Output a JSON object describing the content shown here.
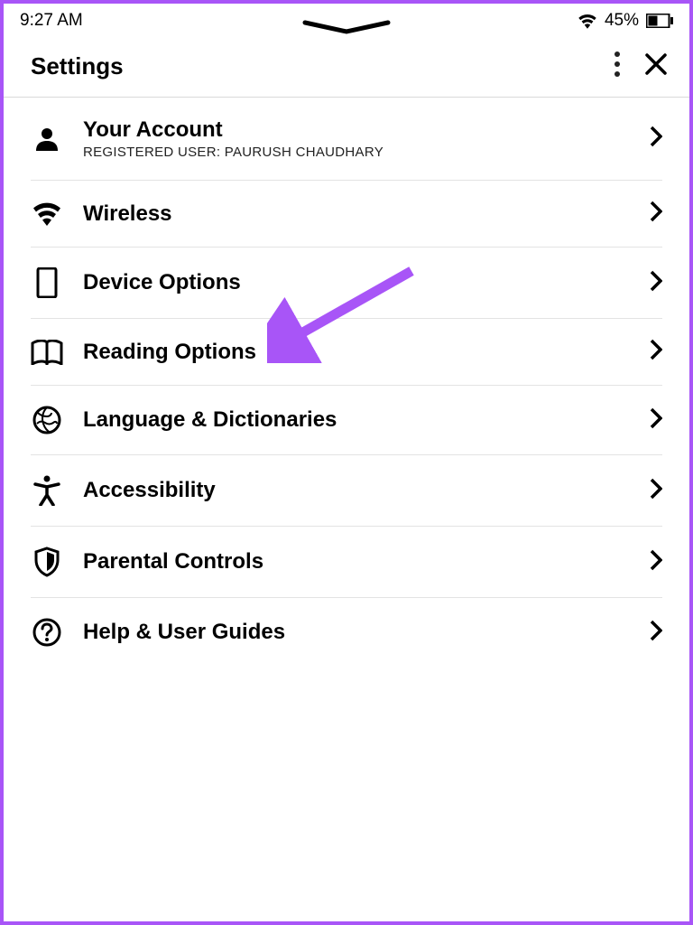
{
  "statusbar": {
    "time": "9:27 AM",
    "battery_percent": "45%"
  },
  "header": {
    "title": "Settings"
  },
  "items": [
    {
      "title": "Your Account",
      "subtitle": "REGISTERED USER: PAURUSH CHAUDHARY",
      "icon": "person"
    },
    {
      "title": "Wireless",
      "icon": "wifi"
    },
    {
      "title": "Device Options",
      "icon": "device"
    },
    {
      "title": "Reading Options",
      "icon": "book"
    },
    {
      "title": "Language & Dictionaries",
      "icon": "globe"
    },
    {
      "title": "Accessibility",
      "icon": "accessibility"
    },
    {
      "title": "Parental Controls",
      "icon": "shield"
    },
    {
      "title": "Help & User Guides",
      "icon": "help"
    }
  ],
  "annotation": {
    "arrow_color": "#a855f7",
    "target": "device-options"
  }
}
